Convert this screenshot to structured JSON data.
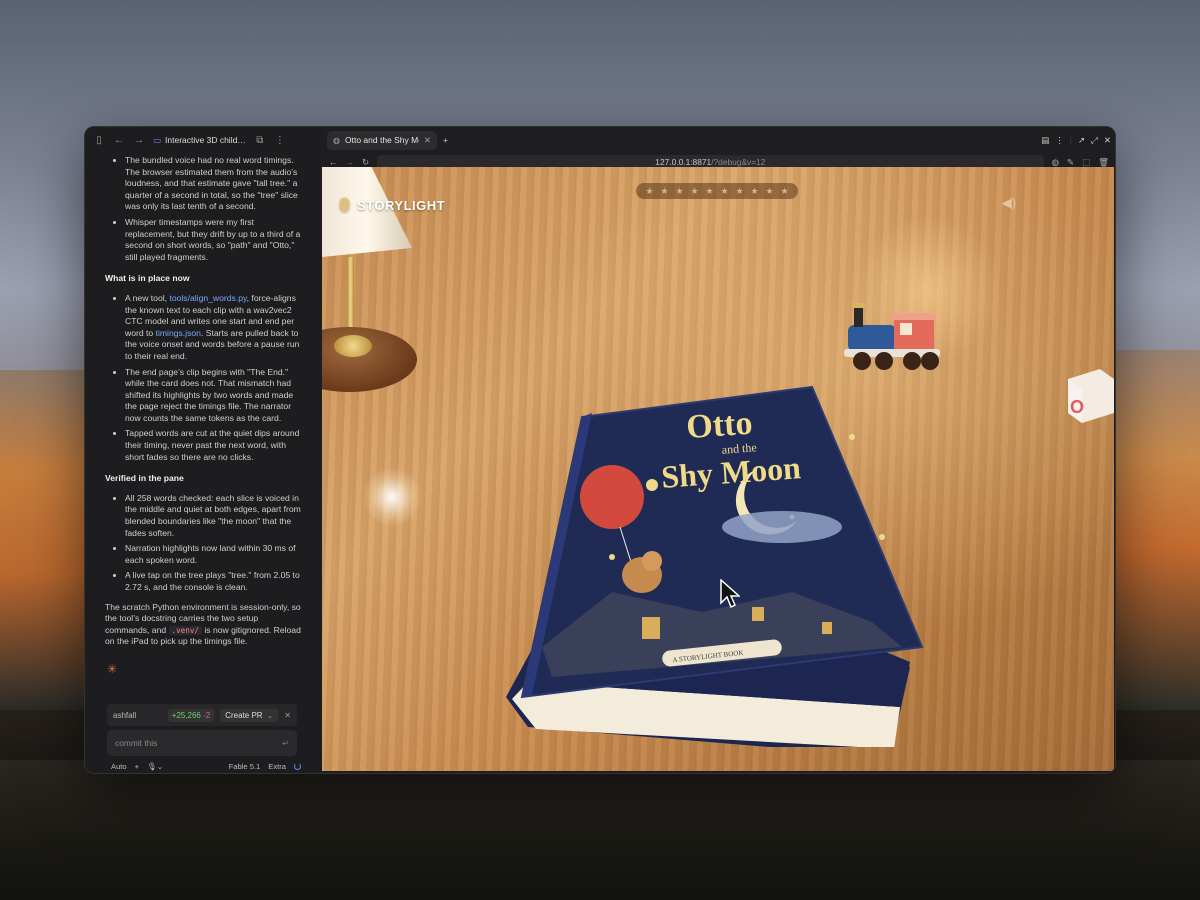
{
  "sidebar": {
    "title": "Interactive 3D child…",
    "bullets_top": [
      "The bundled voice had no real word timings. The browser estimated them from the audio’s loudness, and that estimate gave \"tall tree.\" a quarter of a second in total, so the \"tree\" slice was only its last tenth of a second.",
      "Whisper timestamps were my first replacement, but they drift by up to a third of a second on short words, so \"path\" and \"Otto,\" still played fragments."
    ],
    "heading_now": "What is in place now",
    "now_1_pre": "A new tool, ",
    "now_1_link1": "tools/align_words.py",
    "now_1_mid": ", force-aligns the known text to each clip with a wav2vec2 CTC model and writes one start and end per word to ",
    "now_1_link2": "timings.json",
    "now_1_post": ". Starts are pulled back to the voice onset and words before a pause run to their real end.",
    "now_2": "The end page’s clip begins with \"The End.\" while the card does not. That mismatch had shifted its highlights by two words and made the page reject the timings file. The narrator now counts the same tokens as the card.",
    "now_3": "Tapped words are cut at the quiet dips around their timing, never past the next word, with short fades so there are no clicks.",
    "heading_verified": "Verified in the pane",
    "verified": [
      "All 258 words checked: each slice is voiced in the middle and quiet at both edges, apart from blended boundaries like \"the moon\" that the fades soften.",
      "Narration highlights now land within 30 ms of each spoken word.",
      "A live tap on the tree plays \"tree.\" from 2.05 to 2.72 s, and the console is clean."
    ],
    "closing_pre": "The scratch Python environment is session-only, so the tool’s docstring carries the two setup commands, and ",
    "closing_code": ".venv/",
    "closing_post": " is now gitignored. Reload on the iPad to pick up the timings file.",
    "branch": "ashfall",
    "diff_plus": "+25,266",
    "diff_minus": "-2",
    "create_pr": "Create PR",
    "input_value": "commit this",
    "mode": "Auto",
    "model": "Fable 5.1",
    "effort": "Extra"
  },
  "browser": {
    "tab_title": "Otto and the Shy Moon",
    "url_main": "127.0.0.1:8871",
    "url_rest": "/?debug&v=12"
  },
  "scene": {
    "logo": "STORYLIGHT",
    "book_title_line1": "Otto",
    "book_title_and": "and the",
    "book_title_line2": "Shy Moon",
    "book_ribbon": "A STORYLIGHT BOOK",
    "star_count": 10
  },
  "colors": {
    "accent": "#7aa6ff",
    "diff_plus": "#6fd06f",
    "diff_minus": "#e06a6a",
    "book_cover": "#1f2b55",
    "book_title": "#f1d98a"
  }
}
